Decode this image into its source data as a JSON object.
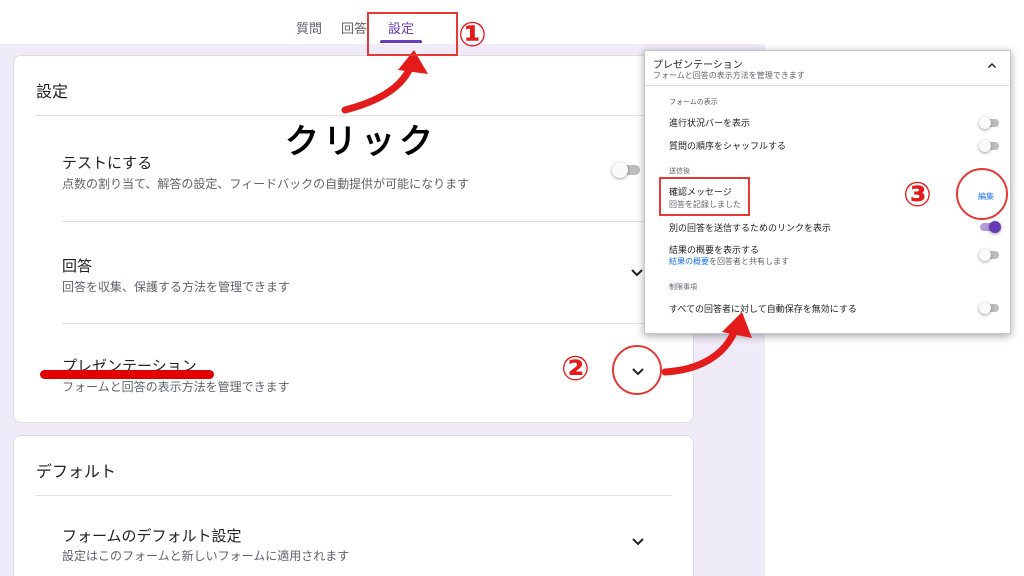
{
  "tabs": {
    "questions": "質問",
    "answers": "回答",
    "settings": "設定"
  },
  "settings_card": {
    "title": "設定",
    "test": {
      "title": "テストにする",
      "sub": "点数の割り当て、解答の設定、フィードバックの自動提供が可能になります"
    },
    "responses": {
      "title": "回答",
      "sub": "回答を収集、保護する方法を管理できます"
    },
    "presentation": {
      "title": "プレゼンテーション",
      "sub": "フォームと回答の表示方法を管理できます"
    }
  },
  "defaults_card": {
    "title": "デフォルト",
    "form_defaults": {
      "title": "フォームのデフォルト設定",
      "sub": "設定はこのフォームと新しいフォームに適用されます"
    }
  },
  "panel": {
    "title": "プレゼンテーション",
    "sub": "フォームと回答の表示方法を管理できます",
    "form_display_heading": "フォームの表示",
    "progress_bar": "進行状況バーを表示",
    "shuffle_questions": "質問の順序をシャッフルする",
    "after_submit_heading": "送信後",
    "confirmation_title": "確認メッセージ",
    "confirmation_value": "回答を記録しました",
    "edit_label": "編集",
    "submit_another": "別の回答を送信するためのリンクを表示",
    "results_summary": "結果の概要を表示する",
    "results_summary_link": "結果の概要",
    "results_summary_rest": "を回答者と共有します",
    "restrictions_heading": "制限事項",
    "disable_autosave": "すべての回答者に対して自動保存を無効にする"
  },
  "annotations": {
    "click_label": "クリック",
    "step1": "①",
    "step2": "②",
    "step3": "③"
  },
  "icons": {
    "chevron": "chevron-down-icon",
    "chevron_up": "chevron-up-icon"
  },
  "toggles": {
    "test": false,
    "progress_bar": false,
    "shuffle_questions": false,
    "submit_another": true,
    "results_summary": false,
    "disable_autosave": false
  },
  "colors": {
    "accent": "#673ab7",
    "background": "#f0ebf8",
    "annotation_red": "#e31b1b",
    "link_blue": "#1a73e8"
  }
}
